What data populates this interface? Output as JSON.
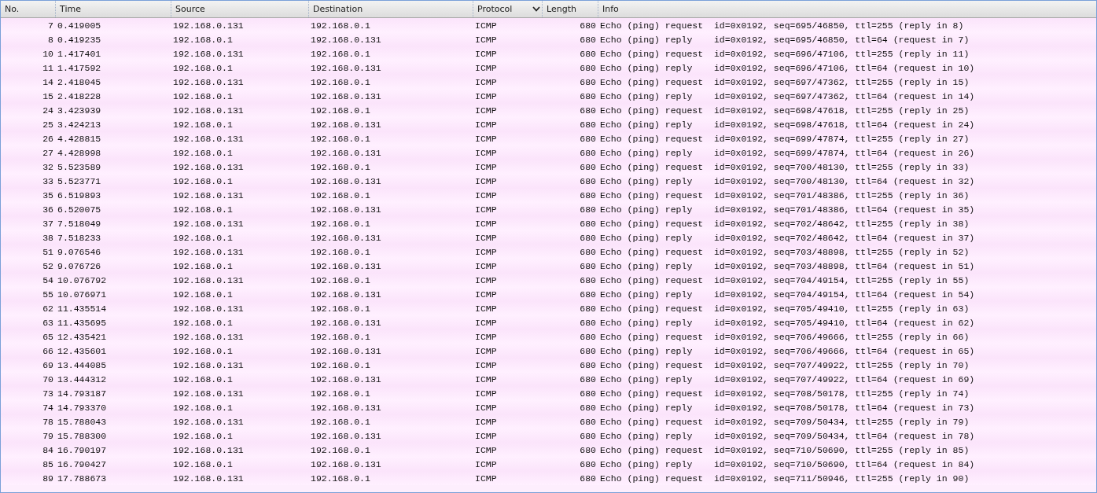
{
  "table": {
    "columns": [
      {
        "label": "No.",
        "sorted": false
      },
      {
        "label": "Time",
        "sorted": false
      },
      {
        "label": "Source",
        "sorted": false
      },
      {
        "label": "Destination",
        "sorted": false
      },
      {
        "label": "Protocol",
        "sorted": true
      },
      {
        "label": "Length",
        "sorted": false
      },
      {
        "label": "Info",
        "sorted": false
      }
    ],
    "rows": [
      {
        "no": "7",
        "time": "0.419005",
        "source": "192.168.0.131",
        "destination": "192.168.0.1",
        "protocol": "ICMP",
        "length": "680",
        "info": "Echo (ping) request  id=0x0192, seq=695/46850, ttl=255 (reply in 8)"
      },
      {
        "no": "8",
        "time": "0.419235",
        "source": "192.168.0.1",
        "destination": "192.168.0.131",
        "protocol": "ICMP",
        "length": "680",
        "info": "Echo (ping) reply    id=0x0192, seq=695/46850, ttl=64 (request in 7)"
      },
      {
        "no": "10",
        "time": "1.417401",
        "source": "192.168.0.131",
        "destination": "192.168.0.1",
        "protocol": "ICMP",
        "length": "680",
        "info": "Echo (ping) request  id=0x0192, seq=696/47106, ttl=255 (reply in 11)"
      },
      {
        "no": "11",
        "time": "1.417592",
        "source": "192.168.0.1",
        "destination": "192.168.0.131",
        "protocol": "ICMP",
        "length": "680",
        "info": "Echo (ping) reply    id=0x0192, seq=696/47106, ttl=64 (request in 10)"
      },
      {
        "no": "14",
        "time": "2.418045",
        "source": "192.168.0.131",
        "destination": "192.168.0.1",
        "protocol": "ICMP",
        "length": "680",
        "info": "Echo (ping) request  id=0x0192, seq=697/47362, ttl=255 (reply in 15)"
      },
      {
        "no": "15",
        "time": "2.418228",
        "source": "192.168.0.1",
        "destination": "192.168.0.131",
        "protocol": "ICMP",
        "length": "680",
        "info": "Echo (ping) reply    id=0x0192, seq=697/47362, ttl=64 (request in 14)"
      },
      {
        "no": "24",
        "time": "3.423939",
        "source": "192.168.0.131",
        "destination": "192.168.0.1",
        "protocol": "ICMP",
        "length": "680",
        "info": "Echo (ping) request  id=0x0192, seq=698/47618, ttl=255 (reply in 25)"
      },
      {
        "no": "25",
        "time": "3.424213",
        "source": "192.168.0.1",
        "destination": "192.168.0.131",
        "protocol": "ICMP",
        "length": "680",
        "info": "Echo (ping) reply    id=0x0192, seq=698/47618, ttl=64 (request in 24)"
      },
      {
        "no": "26",
        "time": "4.428815",
        "source": "192.168.0.131",
        "destination": "192.168.0.1",
        "protocol": "ICMP",
        "length": "680",
        "info": "Echo (ping) request  id=0x0192, seq=699/47874, ttl=255 (reply in 27)"
      },
      {
        "no": "27",
        "time": "4.428998",
        "source": "192.168.0.1",
        "destination": "192.168.0.131",
        "protocol": "ICMP",
        "length": "680",
        "info": "Echo (ping) reply    id=0x0192, seq=699/47874, ttl=64 (request in 26)"
      },
      {
        "no": "32",
        "time": "5.523589",
        "source": "192.168.0.131",
        "destination": "192.168.0.1",
        "protocol": "ICMP",
        "length": "680",
        "info": "Echo (ping) request  id=0x0192, seq=700/48130, ttl=255 (reply in 33)"
      },
      {
        "no": "33",
        "time": "5.523771",
        "source": "192.168.0.1",
        "destination": "192.168.0.131",
        "protocol": "ICMP",
        "length": "680",
        "info": "Echo (ping) reply    id=0x0192, seq=700/48130, ttl=64 (request in 32)"
      },
      {
        "no": "35",
        "time": "6.519893",
        "source": "192.168.0.131",
        "destination": "192.168.0.1",
        "protocol": "ICMP",
        "length": "680",
        "info": "Echo (ping) request  id=0x0192, seq=701/48386, ttl=255 (reply in 36)"
      },
      {
        "no": "36",
        "time": "6.520075",
        "source": "192.168.0.1",
        "destination": "192.168.0.131",
        "protocol": "ICMP",
        "length": "680",
        "info": "Echo (ping) reply    id=0x0192, seq=701/48386, ttl=64 (request in 35)"
      },
      {
        "no": "37",
        "time": "7.518049",
        "source": "192.168.0.131",
        "destination": "192.168.0.1",
        "protocol": "ICMP",
        "length": "680",
        "info": "Echo (ping) request  id=0x0192, seq=702/48642, ttl=255 (reply in 38)"
      },
      {
        "no": "38",
        "time": "7.518233",
        "source": "192.168.0.1",
        "destination": "192.168.0.131",
        "protocol": "ICMP",
        "length": "680",
        "info": "Echo (ping) reply    id=0x0192, seq=702/48642, ttl=64 (request in 37)"
      },
      {
        "no": "51",
        "time": "9.076546",
        "source": "192.168.0.131",
        "destination": "192.168.0.1",
        "protocol": "ICMP",
        "length": "680",
        "info": "Echo (ping) request  id=0x0192, seq=703/48898, ttl=255 (reply in 52)"
      },
      {
        "no": "52",
        "time": "9.076726",
        "source": "192.168.0.1",
        "destination": "192.168.0.131",
        "protocol": "ICMP",
        "length": "680",
        "info": "Echo (ping) reply    id=0x0192, seq=703/48898, ttl=64 (request in 51)"
      },
      {
        "no": "54",
        "time": "10.076792",
        "source": "192.168.0.131",
        "destination": "192.168.0.1",
        "protocol": "ICMP",
        "length": "680",
        "info": "Echo (ping) request  id=0x0192, seq=704/49154, ttl=255 (reply in 55)"
      },
      {
        "no": "55",
        "time": "10.076971",
        "source": "192.168.0.1",
        "destination": "192.168.0.131",
        "protocol": "ICMP",
        "length": "680",
        "info": "Echo (ping) reply    id=0x0192, seq=704/49154, ttl=64 (request in 54)"
      },
      {
        "no": "62",
        "time": "11.435514",
        "source": "192.168.0.131",
        "destination": "192.168.0.1",
        "protocol": "ICMP",
        "length": "680",
        "info": "Echo (ping) request  id=0x0192, seq=705/49410, ttl=255 (reply in 63)"
      },
      {
        "no": "63",
        "time": "11.435695",
        "source": "192.168.0.1",
        "destination": "192.168.0.131",
        "protocol": "ICMP",
        "length": "680",
        "info": "Echo (ping) reply    id=0x0192, seq=705/49410, ttl=64 (request in 62)"
      },
      {
        "no": "65",
        "time": "12.435421",
        "source": "192.168.0.131",
        "destination": "192.168.0.1",
        "protocol": "ICMP",
        "length": "680",
        "info": "Echo (ping) request  id=0x0192, seq=706/49666, ttl=255 (reply in 66)"
      },
      {
        "no": "66",
        "time": "12.435601",
        "source": "192.168.0.1",
        "destination": "192.168.0.131",
        "protocol": "ICMP",
        "length": "680",
        "info": "Echo (ping) reply    id=0x0192, seq=706/49666, ttl=64 (request in 65)"
      },
      {
        "no": "69",
        "time": "13.444085",
        "source": "192.168.0.131",
        "destination": "192.168.0.1",
        "protocol": "ICMP",
        "length": "680",
        "info": "Echo (ping) request  id=0x0192, seq=707/49922, ttl=255 (reply in 70)"
      },
      {
        "no": "70",
        "time": "13.444312",
        "source": "192.168.0.1",
        "destination": "192.168.0.131",
        "protocol": "ICMP",
        "length": "680",
        "info": "Echo (ping) reply    id=0x0192, seq=707/49922, ttl=64 (request in 69)"
      },
      {
        "no": "73",
        "time": "14.793187",
        "source": "192.168.0.131",
        "destination": "192.168.0.1",
        "protocol": "ICMP",
        "length": "680",
        "info": "Echo (ping) request  id=0x0192, seq=708/50178, ttl=255 (reply in 74)"
      },
      {
        "no": "74",
        "time": "14.793370",
        "source": "192.168.0.1",
        "destination": "192.168.0.131",
        "protocol": "ICMP",
        "length": "680",
        "info": "Echo (ping) reply    id=0x0192, seq=708/50178, ttl=64 (request in 73)"
      },
      {
        "no": "78",
        "time": "15.788043",
        "source": "192.168.0.131",
        "destination": "192.168.0.1",
        "protocol": "ICMP",
        "length": "680",
        "info": "Echo (ping) request  id=0x0192, seq=709/50434, ttl=255 (reply in 79)"
      },
      {
        "no": "79",
        "time": "15.788300",
        "source": "192.168.0.1",
        "destination": "192.168.0.131",
        "protocol": "ICMP",
        "length": "680",
        "info": "Echo (ping) reply    id=0x0192, seq=709/50434, ttl=64 (request in 78)"
      },
      {
        "no": "84",
        "time": "16.790197",
        "source": "192.168.0.131",
        "destination": "192.168.0.1",
        "protocol": "ICMP",
        "length": "680",
        "info": "Echo (ping) request  id=0x0192, seq=710/50690, ttl=255 (reply in 85)"
      },
      {
        "no": "85",
        "time": "16.790427",
        "source": "192.168.0.1",
        "destination": "192.168.0.131",
        "protocol": "ICMP",
        "length": "680",
        "info": "Echo (ping) reply    id=0x0192, seq=710/50690, ttl=64 (request in 84)"
      },
      {
        "no": "89",
        "time": "17.788673",
        "source": "192.168.0.131",
        "destination": "192.168.0.1",
        "protocol": "ICMP",
        "length": "680",
        "info": "Echo (ping) request  id=0x0192, seq=711/50946, ttl=255 (reply in 90)"
      }
    ]
  }
}
